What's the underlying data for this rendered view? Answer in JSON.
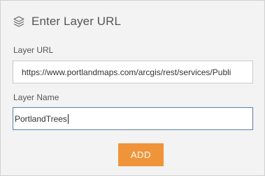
{
  "header": {
    "icon": "layers-icon",
    "title": "Enter Layer URL"
  },
  "fields": {
    "url": {
      "label": "Layer URL",
      "value": "https://www.portlandmaps.com/arcgis/rest/services/Publi"
    },
    "name": {
      "label": "Layer Name",
      "value": "PortlandTrees"
    }
  },
  "actions": {
    "add_label": "ADD",
    "add_color": "#f0943a"
  }
}
